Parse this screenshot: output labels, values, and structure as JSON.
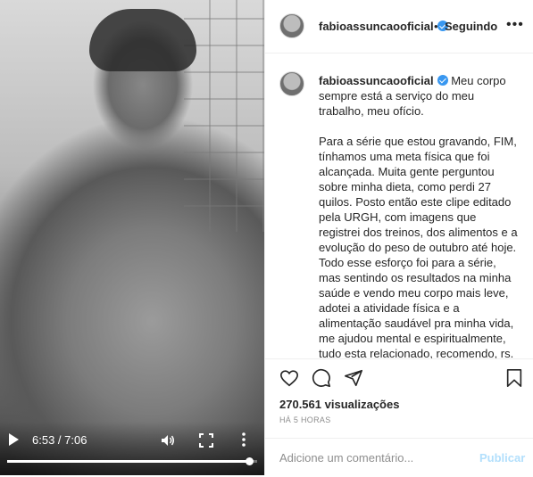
{
  "video": {
    "time_display": "6:53 / 7:06",
    "progress_fraction": 0.97
  },
  "header": {
    "username": "fabioassuncaooficial",
    "separator": "•",
    "follow_label": "Seguindo",
    "more_label": "•••"
  },
  "caption": {
    "username": "fabioassuncaooficial",
    "paragraph1": "Meu corpo sempre está a serviço do meu trabalho, meu ofício.",
    "paragraph2": "Para a série que estou gravando, FIM, tínhamos uma meta física que foi alcançada. Muita gente perguntou sobre minha dieta, como perdi 27 quilos. Posto então este clipe editado pela URGH, com imagens que registrei dos treinos, dos alimentos e a evolução do peso de outubro até hoje. Todo esse esforço foi para a série, mas sentindo os resultados na minha saúde e vendo meu corpo mais leve, adotei a atividade física e a alimentação saudável pra minha vida, me ajudou mental e espiritualmente, tudo esta relacionado, recomendo, rs. Contei com a ajuda e orientação de"
  },
  "stats": {
    "views_count": "270.561",
    "views_label": "visualizações",
    "time_ago": "HÁ 5 HORAS"
  },
  "comment": {
    "placeholder": "Adicione um comentário...",
    "publish_label": "Publicar"
  },
  "colors": {
    "verified": "#3897f0",
    "publish_disabled": "#b2dffc",
    "muted": "#8e8e8e"
  }
}
